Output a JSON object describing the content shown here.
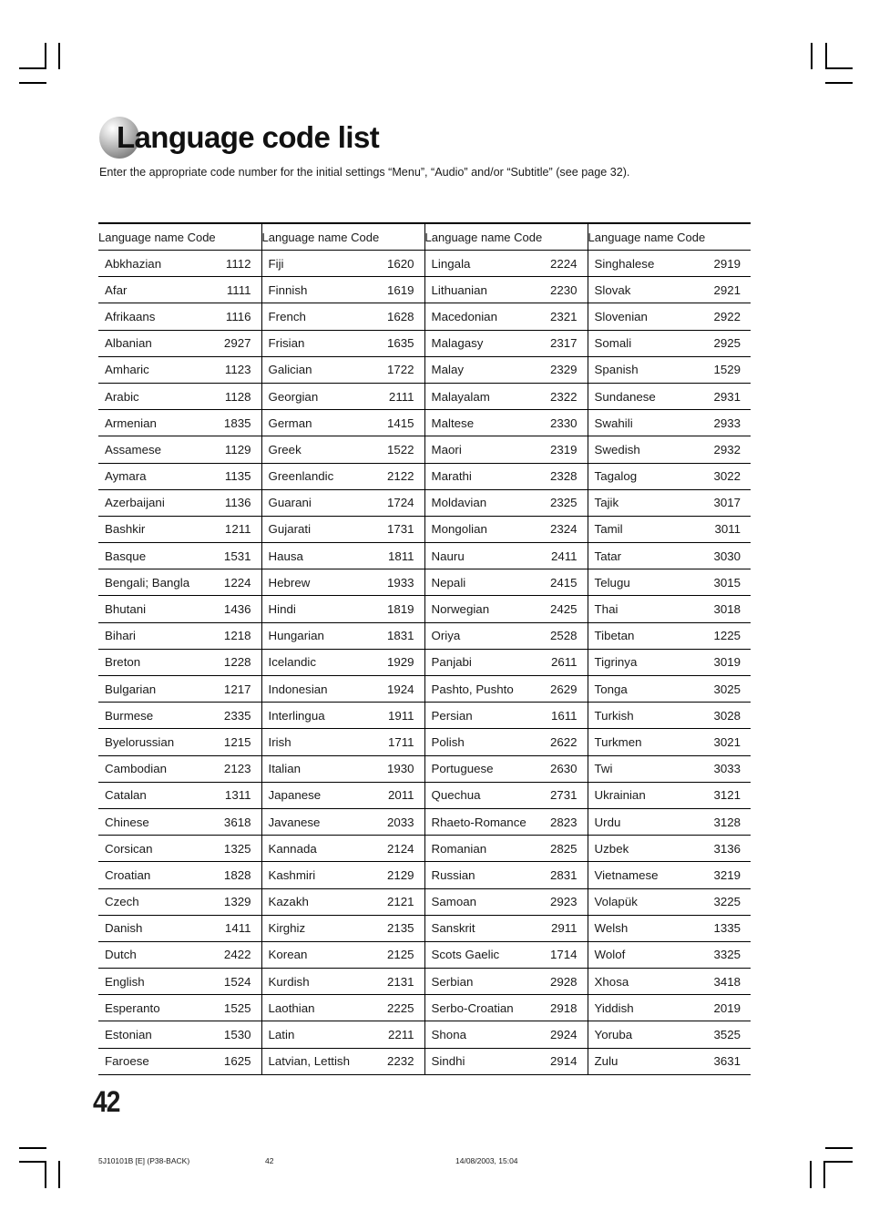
{
  "document": {
    "title": "Language code list",
    "subtitle": "Enter the appropriate code number for the initial settings “Menu”, “Audio” and/or “Subtitle” (see page 32).",
    "page_number": "42"
  },
  "table": {
    "headers": [
      "Language name Code",
      "Language name Code",
      "Language name Code",
      "Language name Code"
    ],
    "columns": [
      [
        {
          "name": "Abkhazian",
          "code": "1112"
        },
        {
          "name": "Afar",
          "code": "1111"
        },
        {
          "name": "Afrikaans",
          "code": "1116"
        },
        {
          "name": "Albanian",
          "code": "2927"
        },
        {
          "name": "Amharic",
          "code": "1123"
        },
        {
          "name": "Arabic",
          "code": "1128"
        },
        {
          "name": "Armenian",
          "code": "1835"
        },
        {
          "name": "Assamese",
          "code": "1129"
        },
        {
          "name": "Aymara",
          "code": "1135"
        },
        {
          "name": "Azerbaijani",
          "code": "1136"
        },
        {
          "name": "Bashkir",
          "code": "1211"
        },
        {
          "name": "Basque",
          "code": "1531"
        },
        {
          "name": "Bengali; Bangla",
          "code": "1224"
        },
        {
          "name": "Bhutani",
          "code": "1436"
        },
        {
          "name": "Bihari",
          "code": "1218"
        },
        {
          "name": "Breton",
          "code": "1228"
        },
        {
          "name": "Bulgarian",
          "code": "1217"
        },
        {
          "name": "Burmese",
          "code": "2335"
        },
        {
          "name": "Byelorussian",
          "code": "1215"
        },
        {
          "name": "Cambodian",
          "code": "2123"
        },
        {
          "name": "Catalan",
          "code": "1311"
        },
        {
          "name": "Chinese",
          "code": "3618"
        },
        {
          "name": "Corsican",
          "code": "1325"
        },
        {
          "name": "Croatian",
          "code": "1828"
        },
        {
          "name": "Czech",
          "code": "1329"
        },
        {
          "name": "Danish",
          "code": "1411"
        },
        {
          "name": "Dutch",
          "code": "2422"
        },
        {
          "name": "English",
          "code": "1524"
        },
        {
          "name": "Esperanto",
          "code": "1525"
        },
        {
          "name": "Estonian",
          "code": "1530"
        },
        {
          "name": "Faroese",
          "code": "1625"
        }
      ],
      [
        {
          "name": "Fiji",
          "code": "1620"
        },
        {
          "name": "Finnish",
          "code": "1619"
        },
        {
          "name": "French",
          "code": "1628"
        },
        {
          "name": "Frisian",
          "code": "1635"
        },
        {
          "name": "Galician",
          "code": "1722"
        },
        {
          "name": "Georgian",
          "code": "2111"
        },
        {
          "name": "German",
          "code": "1415"
        },
        {
          "name": "Greek",
          "code": "1522"
        },
        {
          "name": "Greenlandic",
          "code": "2122"
        },
        {
          "name": "Guarani",
          "code": "1724"
        },
        {
          "name": "Gujarati",
          "code": "1731"
        },
        {
          "name": "Hausa",
          "code": "1811"
        },
        {
          "name": "Hebrew",
          "code": "1933"
        },
        {
          "name": "Hindi",
          "code": "1819"
        },
        {
          "name": "Hungarian",
          "code": "1831"
        },
        {
          "name": "Icelandic",
          "code": "1929"
        },
        {
          "name": "Indonesian",
          "code": "1924"
        },
        {
          "name": "Interlingua",
          "code": "1911"
        },
        {
          "name": "Irish",
          "code": "1711"
        },
        {
          "name": "Italian",
          "code": "1930"
        },
        {
          "name": "Japanese",
          "code": "2011"
        },
        {
          "name": "Javanese",
          "code": "2033"
        },
        {
          "name": "Kannada",
          "code": "2124"
        },
        {
          "name": "Kashmiri",
          "code": "2129"
        },
        {
          "name": "Kazakh",
          "code": "2121"
        },
        {
          "name": "Kirghiz",
          "code": "2135"
        },
        {
          "name": "Korean",
          "code": "2125"
        },
        {
          "name": "Kurdish",
          "code": "2131"
        },
        {
          "name": "Laothian",
          "code": "2225"
        },
        {
          "name": "Latin",
          "code": "2211"
        },
        {
          "name": "Latvian, Lettish",
          "code": "2232"
        }
      ],
      [
        {
          "name": "Lingala",
          "code": "2224"
        },
        {
          "name": "Lithuanian",
          "code": "2230"
        },
        {
          "name": "Macedonian",
          "code": "2321"
        },
        {
          "name": "Malagasy",
          "code": "2317"
        },
        {
          "name": "Malay",
          "code": "2329"
        },
        {
          "name": "Malayalam",
          "code": "2322"
        },
        {
          "name": "Maltese",
          "code": "2330"
        },
        {
          "name": "Maori",
          "code": "2319"
        },
        {
          "name": "Marathi",
          "code": "2328"
        },
        {
          "name": "Moldavian",
          "code": "2325"
        },
        {
          "name": "Mongolian",
          "code": "2324"
        },
        {
          "name": "Nauru",
          "code": "2411"
        },
        {
          "name": "Nepali",
          "code": "2415"
        },
        {
          "name": "Norwegian",
          "code": "2425"
        },
        {
          "name": "Oriya",
          "code": "2528"
        },
        {
          "name": "Panjabi",
          "code": "2611"
        },
        {
          "name": "Pashto, Pushto",
          "code": "2629"
        },
        {
          "name": "Persian",
          "code": "1611"
        },
        {
          "name": "Polish",
          "code": "2622"
        },
        {
          "name": "Portuguese",
          "code": "2630"
        },
        {
          "name": "Quechua",
          "code": "2731"
        },
        {
          "name": "Rhaeto-Romance",
          "code": "2823"
        },
        {
          "name": "Romanian",
          "code": "2825"
        },
        {
          "name": "Russian",
          "code": "2831"
        },
        {
          "name": "Samoan",
          "code": "2923"
        },
        {
          "name": "Sanskrit",
          "code": "2911"
        },
        {
          "name": "Scots Gaelic",
          "code": "1714"
        },
        {
          "name": "Serbian",
          "code": "2928"
        },
        {
          "name": "Serbo-Croatian",
          "code": "2918"
        },
        {
          "name": "Shona",
          "code": "2924"
        },
        {
          "name": "Sindhi",
          "code": "2914"
        }
      ],
      [
        {
          "name": "Singhalese",
          "code": "2919"
        },
        {
          "name": "Slovak",
          "code": "2921"
        },
        {
          "name": "Slovenian",
          "code": "2922"
        },
        {
          "name": "Somali",
          "code": "2925"
        },
        {
          "name": "Spanish",
          "code": "1529"
        },
        {
          "name": "Sundanese",
          "code": "2931"
        },
        {
          "name": "Swahili",
          "code": "2933"
        },
        {
          "name": "Swedish",
          "code": "2932"
        },
        {
          "name": "Tagalog",
          "code": "3022"
        },
        {
          "name": "Tajik",
          "code": "3017"
        },
        {
          "name": "Tamil",
          "code": "3011"
        },
        {
          "name": "Tatar",
          "code": "3030"
        },
        {
          "name": "Telugu",
          "code": "3015"
        },
        {
          "name": "Thai",
          "code": "3018"
        },
        {
          "name": "Tibetan",
          "code": "1225"
        },
        {
          "name": "Tigrinya",
          "code": "3019"
        },
        {
          "name": "Tonga",
          "code": "3025"
        },
        {
          "name": "Turkish",
          "code": "3028"
        },
        {
          "name": "Turkmen",
          "code": "3021"
        },
        {
          "name": "Twi",
          "code": "3033"
        },
        {
          "name": "Ukrainian",
          "code": "3121"
        },
        {
          "name": "Urdu",
          "code": "3128"
        },
        {
          "name": "Uzbek",
          "code": "3136"
        },
        {
          "name": "Vietnamese",
          "code": "3219"
        },
        {
          "name": "Volapük",
          "code": "3225"
        },
        {
          "name": "Welsh",
          "code": "1335"
        },
        {
          "name": "Wolof",
          "code": "3325"
        },
        {
          "name": "Xhosa",
          "code": "3418"
        },
        {
          "name": "Yiddish",
          "code": "2019"
        },
        {
          "name": "Yoruba",
          "code": "3525"
        },
        {
          "name": "Zulu",
          "code": "3631"
        }
      ]
    ]
  },
  "footer": {
    "doc_code": "5J10101B [E] (P38-BACK)",
    "page": "42",
    "timestamp": "14/08/2003, 15:04"
  }
}
